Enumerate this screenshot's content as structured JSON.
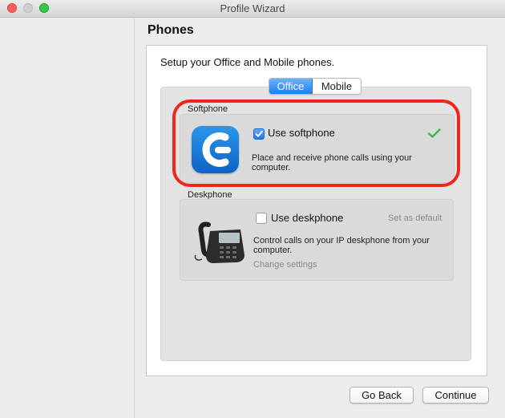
{
  "window": {
    "title": "Profile Wizard"
  },
  "page": {
    "title": "Phones",
    "intro": "Setup your Office and Mobile phones."
  },
  "tabs": {
    "office": "Office",
    "mobile": "Mobile",
    "selected": "Office"
  },
  "softphone": {
    "group_label": "Softphone",
    "checkbox_label": "Use softphone",
    "checked": true,
    "is_default": true,
    "description": "Place and receive phone calls using your computer."
  },
  "deskphone": {
    "group_label": "Deskphone",
    "checkbox_label": "Use deskphone",
    "checked": false,
    "set_default": "Set as default",
    "description": "Control calls on your IP deskphone from your computer.",
    "change_settings": "Change settings"
  },
  "footer": {
    "back": "Go Back",
    "continue": "Continue"
  },
  "colors": {
    "accent": "#1e7ef4",
    "highlight": "#f1261a",
    "check": "#3cb84a"
  }
}
